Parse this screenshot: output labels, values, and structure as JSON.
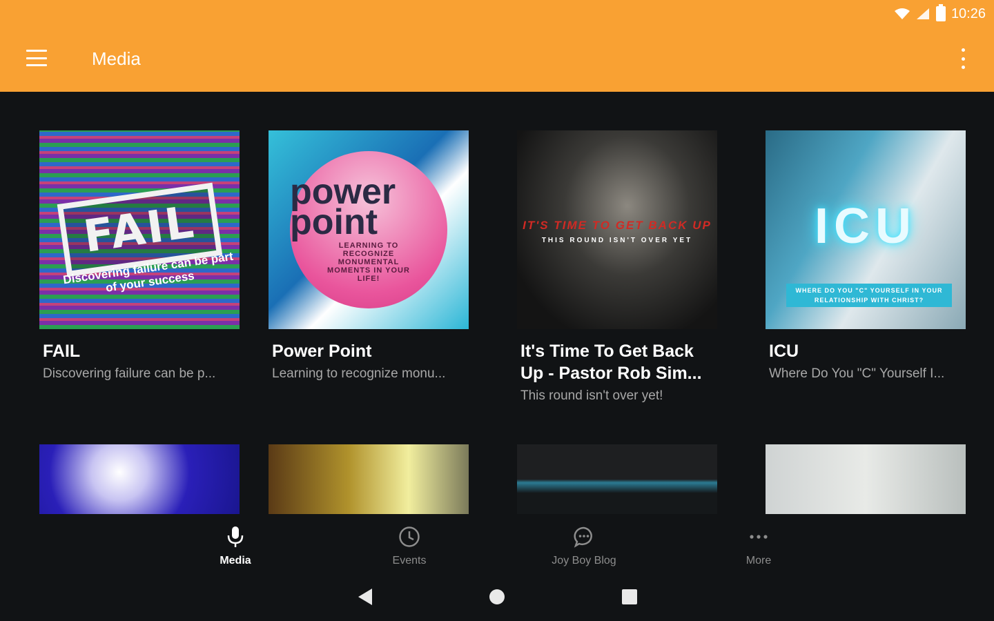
{
  "status_bar": {
    "time": "10:26"
  },
  "app_bar": {
    "title": "Media",
    "menu_icon": "hamburger-icon",
    "overflow_icon": "more-vert-icon",
    "background": "#F9A133"
  },
  "cards": [
    {
      "title": "FAIL",
      "subtitle": "Discovering failure can be p...",
      "art_word": "FAIL",
      "art_tagline": "Discovering failure can be part of your success"
    },
    {
      "title": "Power Point",
      "subtitle": "Learning to recognize monu...",
      "art_word": "power point",
      "art_tagline": "LEARNING TO RECOGNIZE MONUMENTAL MOMENTS IN YOUR LIFE!"
    },
    {
      "title": "It's Time To Get Back Up - Pastor Rob Sim...",
      "subtitle": "This round isn't over yet!",
      "art_word": "IT'S TIME TO GET BACK UP",
      "art_tagline": "THIS ROUND ISN'T OVER YET"
    },
    {
      "title": "ICU",
      "subtitle": "Where Do You \"C\" Yourself I...",
      "art_word": "ICU",
      "art_tagline": "WHERE DO YOU \"C\" YOURSELF IN YOUR RELATIONSHIP WITH CHRIST?"
    }
  ],
  "bottom_nav": [
    {
      "label": "Media",
      "icon": "microphone-icon",
      "active": true
    },
    {
      "label": "Events",
      "icon": "clock-icon",
      "active": false
    },
    {
      "label": "Joy Boy Blog",
      "icon": "chat-bubble-icon",
      "active": false
    },
    {
      "label": "More",
      "icon": "more-horiz-icon",
      "active": false
    }
  ],
  "system_nav": [
    "back-icon",
    "home-icon",
    "recents-icon"
  ]
}
